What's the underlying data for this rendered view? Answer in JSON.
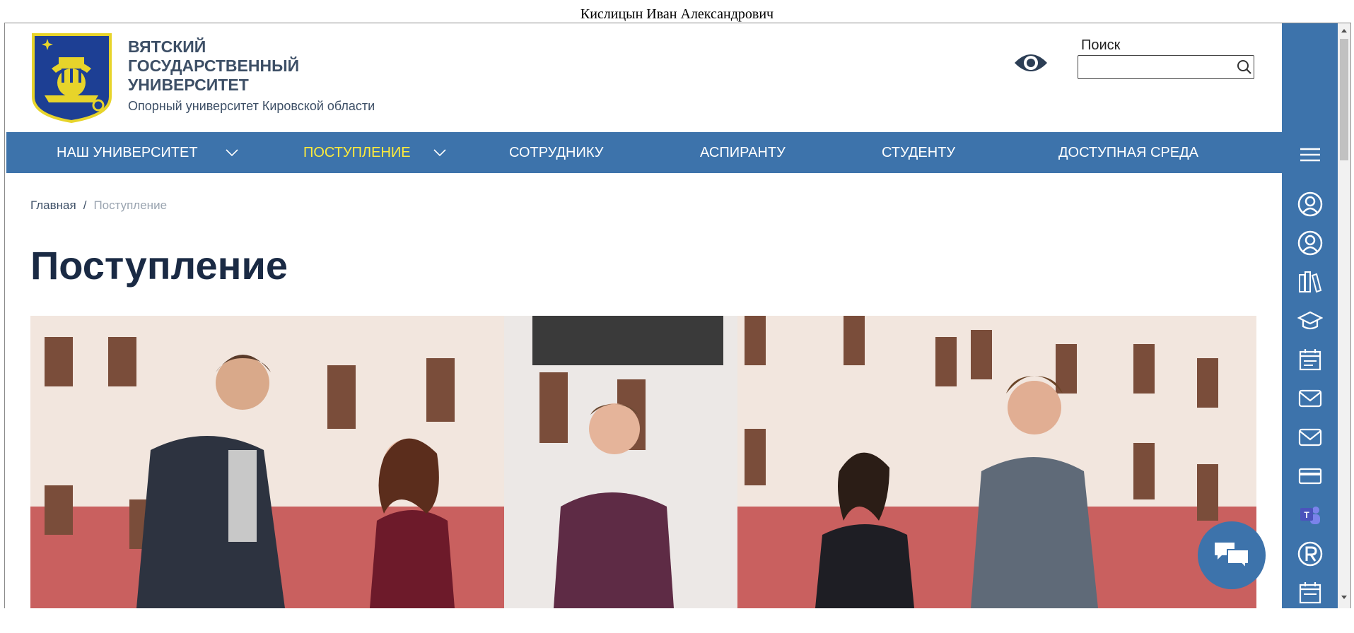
{
  "window": {
    "user_name": "Кислицын Иван Александрович"
  },
  "header": {
    "university_name": "ВЯТСКИЙ\nГОСУДАРСТВЕННЫЙ\nУНИВЕРСИТЕТ",
    "tagline": "Опорный университет Кировской области",
    "search_label": "Поиск",
    "search_value": "",
    "icons": {
      "accessibility": "eye-icon",
      "search": "search-icon"
    }
  },
  "nav": {
    "items": [
      {
        "label": "НАШ УНИВЕРСИТЕТ",
        "has_dropdown": true,
        "active": false
      },
      {
        "label": "ПОСТУПЛЕНИЕ",
        "has_dropdown": true,
        "active": true
      },
      {
        "label": "СОТРУДНИКУ",
        "has_dropdown": false,
        "active": false
      },
      {
        "label": "АСПИРАНТУ",
        "has_dropdown": false,
        "active": false
      },
      {
        "label": "СТУДЕНТУ",
        "has_dropdown": false,
        "active": false
      },
      {
        "label": "ДОСТУПНАЯ СРЕДА",
        "has_dropdown": false,
        "active": false
      }
    ]
  },
  "breadcrumb": {
    "home": "Главная",
    "separator": "/",
    "current": "Поступление"
  },
  "page": {
    "title": "Поступление"
  },
  "sidebar": {
    "icons": [
      "menu-icon",
      "user-icon",
      "user-icon",
      "library-icon",
      "graduation-cap-icon",
      "calendar-icon",
      "mail-icon",
      "mail-icon",
      "card-icon",
      "teams-icon",
      "r-logo-icon",
      "calendar-icon"
    ]
  },
  "chat": {
    "icon": "chat-icon"
  },
  "colors": {
    "nav_bg": "#3d73ab",
    "active_nav": "#ffeb3b",
    "title": "#1a2a44",
    "text": "#3d4f66"
  }
}
